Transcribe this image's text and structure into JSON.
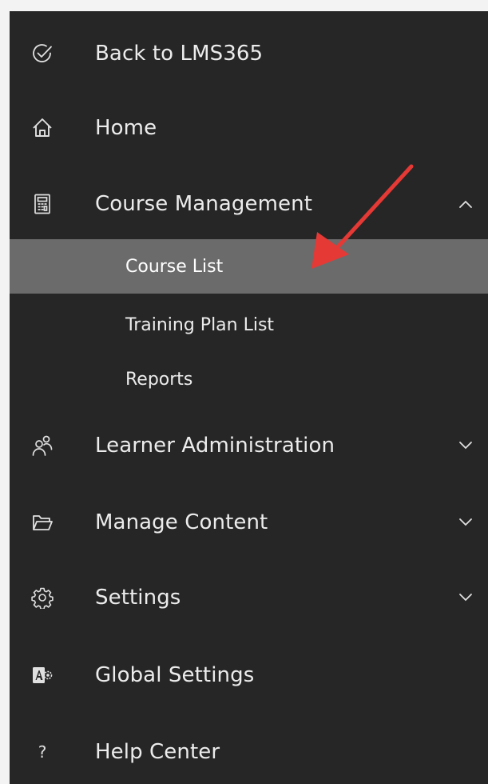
{
  "nav": {
    "items": [
      {
        "label": "Back to LMS365",
        "icon": "check-circle-icon"
      },
      {
        "label": "Home",
        "icon": "home-icon"
      },
      {
        "label": "Course Management",
        "icon": "calculator-icon",
        "chevron": "up"
      },
      {
        "label": "Learner Administration",
        "icon": "people-icon",
        "chevron": "down"
      },
      {
        "label": "Manage Content",
        "icon": "folder-open-icon",
        "chevron": "down"
      },
      {
        "label": "Settings",
        "icon": "gear-icon",
        "chevron": "down"
      },
      {
        "label": "Global Settings",
        "icon": "admin-settings-icon"
      },
      {
        "label": "Help Center",
        "icon": "question-icon",
        "glyph": "?"
      }
    ],
    "course_management_sub": [
      {
        "label": "Course List",
        "selected": true
      },
      {
        "label": "Training Plan List"
      },
      {
        "label": "Reports"
      }
    ]
  },
  "colors": {
    "sidebar_bg": "#262626",
    "selected_bg": "#6b6b6b",
    "text": "#ececec",
    "annotation_arrow": "#e53935"
  }
}
